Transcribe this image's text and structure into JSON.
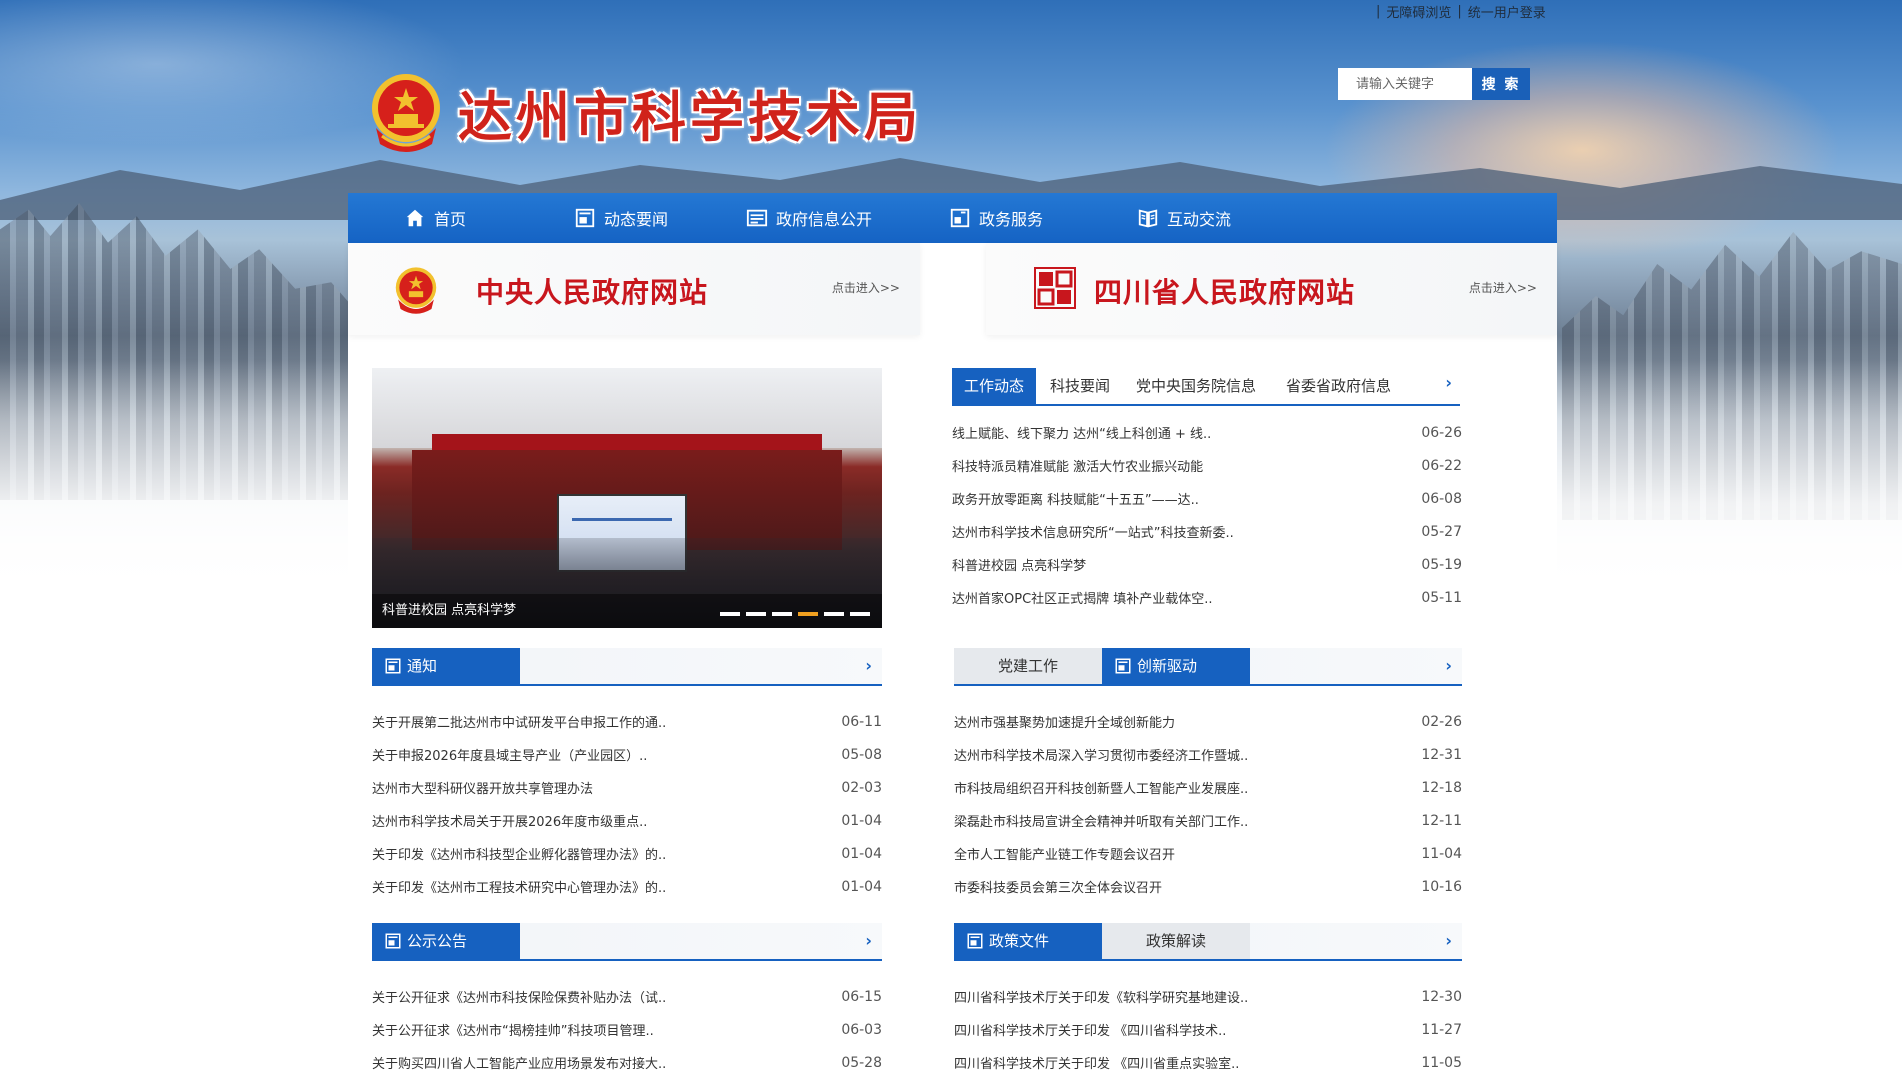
{
  "top_links": {
    "accessibility": "无障碍浏览",
    "login": "统一用户登录",
    "separator": "|"
  },
  "site": {
    "title": "达州市科学技术局"
  },
  "search": {
    "placeholder": "请输入关键字",
    "button": "搜 索"
  },
  "nav": {
    "items": [
      {
        "label": "首页",
        "icon": "home-icon"
      },
      {
        "label": "动态要闻",
        "icon": "news-icon"
      },
      {
        "label": "政府信息公开",
        "icon": "info-icon"
      },
      {
        "label": "政务服务",
        "icon": "service-icon"
      },
      {
        "label": "互动交流",
        "icon": "book-icon"
      }
    ]
  },
  "gov_links": [
    {
      "title": "中央人民政府网站",
      "enter": "点击进入>>"
    },
    {
      "title": "四川省人民政府网站",
      "enter": "点击进入>>"
    }
  ],
  "slideshow": {
    "caption": "科普进校园 点亮科学梦",
    "dot_count": 6,
    "active_dot": 3
  },
  "work_tabs": {
    "tabs": [
      "工作动态",
      "科技要闻",
      "党中央国务院信息",
      "省委省政府信息"
    ],
    "active": 0,
    "items": [
      {
        "title": "线上赋能、线下聚力 达州“线上科创通 + 线..",
        "date": "06-26"
      },
      {
        "title": "科技特派员精准赋能 激活大竹农业振兴动能",
        "date": "06-22"
      },
      {
        "title": "政务开放零距离 科技赋能“十五五”——达..",
        "date": "06-08"
      },
      {
        "title": "达州市科学技术信息研究所“一站式”科技查新委..",
        "date": "05-27"
      },
      {
        "title": "科普进校园 点亮科学梦",
        "date": "05-19"
      },
      {
        "title": "达州首家OPC社区正式揭牌 填补产业载体空..",
        "date": "05-11"
      }
    ]
  },
  "notice": {
    "tab": "通知",
    "items": [
      {
        "title": "关于开展第二批达州市中试研发平台申报工作的通..",
        "date": "06-11"
      },
      {
        "title": "关于申报2026年度县域主导产业（产业园区）..",
        "date": "05-08"
      },
      {
        "title": "达州市大型科研仪器开放共享管理办法",
        "date": "02-03"
      },
      {
        "title": "达州市科学技术局关于开展2026年度市级重点..",
        "date": "01-04"
      },
      {
        "title": "关于印发《达州市科技型企业孵化器管理办法》的..",
        "date": "01-04"
      },
      {
        "title": "关于印发《达州市工程技术研究中心管理办法》的..",
        "date": "01-04"
      }
    ]
  },
  "innovation": {
    "tabs": [
      "党建工作",
      "创新驱动"
    ],
    "active": 1,
    "items": [
      {
        "title": "达州市强基聚势加速提升全域创新能力",
        "date": "02-26"
      },
      {
        "title": "达州市科学技术局深入学习贯彻市委经济工作暨城..",
        "date": "12-31"
      },
      {
        "title": "市科技局组织召开科技创新暨人工智能产业发展座..",
        "date": "12-18"
      },
      {
        "title": "梁磊赴市科技局宣讲全会精神并听取有关部门工作..",
        "date": "12-11"
      },
      {
        "title": "全市人工智能产业链工作专题会议召开",
        "date": "11-04"
      },
      {
        "title": "市委科技委员会第三次全体会议召开",
        "date": "10-16"
      }
    ]
  },
  "announcement": {
    "tab": "公示公告",
    "items": [
      {
        "title": "关于公开征求《达州市科技保险保费补贴办法（试..",
        "date": "06-15"
      },
      {
        "title": "关于公开征求《达州市“揭榜挂帅”科技项目管理..",
        "date": "06-03"
      },
      {
        "title": "关于购买四川省人工智能产业应用场景发布对接大..",
        "date": "05-28"
      }
    ]
  },
  "policy": {
    "tabs": [
      "政策文件",
      "政策解读"
    ],
    "active": 0,
    "items": [
      {
        "title": "四川省科学技术厅关于印发《软科学研究基地建设..",
        "date": "12-30"
      },
      {
        "title": "四川省科学技术厅关于印发 《四川省科学技术..",
        "date": "11-27"
      },
      {
        "title": "四川省科学技术厅关于印发 《四川省重点实验室..",
        "date": "11-05"
      }
    ]
  },
  "colors": {
    "primary": "#1661c0",
    "title_red": "#d0231b",
    "active_dot": "#f0a020"
  }
}
